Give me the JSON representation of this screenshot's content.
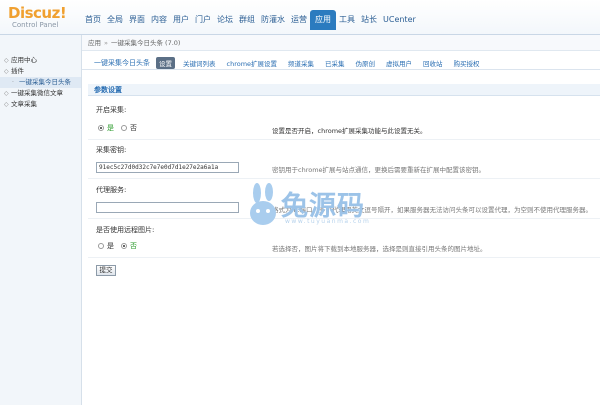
{
  "logo": {
    "main": "Discuz!",
    "sub": "Control Panel"
  },
  "topnav": [
    {
      "label": "首页",
      "active": false
    },
    {
      "label": "全局",
      "active": false
    },
    {
      "label": "界面",
      "active": false
    },
    {
      "label": "内容",
      "active": false
    },
    {
      "label": "用户",
      "active": false
    },
    {
      "label": "门户",
      "active": false
    },
    {
      "label": "论坛",
      "active": false
    },
    {
      "label": "群组",
      "active": false
    },
    {
      "label": "防灌水",
      "active": false
    },
    {
      "label": "运营",
      "active": false
    },
    {
      "label": "应用",
      "active": true
    },
    {
      "label": "工具",
      "active": false
    },
    {
      "label": "站长",
      "active": false
    },
    {
      "label": "UCenter",
      "active": false
    }
  ],
  "sidebar": [
    {
      "label": "应用中心",
      "sub": false,
      "active": false
    },
    {
      "label": "插件",
      "sub": false,
      "active": false
    },
    {
      "label": "一键采集今日头条",
      "sub": true,
      "active": true
    },
    {
      "label": "一键采集微信文章",
      "sub": false,
      "active": false
    },
    {
      "label": "文章采集",
      "sub": false,
      "active": false
    }
  ],
  "breadcrumb": {
    "root": "应用",
    "current": "一键采集今日头条 (7.0)"
  },
  "subnav": {
    "plugin_name": "一键采集今日头条",
    "tabs": [
      {
        "label": "设置",
        "active": true
      },
      {
        "label": "关键词列表",
        "active": false
      },
      {
        "label": "chrome扩展设置",
        "active": false
      },
      {
        "label": "频道采集",
        "active": false
      },
      {
        "label": "已采集",
        "active": false
      },
      {
        "label": "伪原创",
        "active": false
      },
      {
        "label": "虚拟用户",
        "active": false
      },
      {
        "label": "回收站",
        "active": false
      },
      {
        "label": "购买授权",
        "active": false
      }
    ]
  },
  "section": {
    "title": "参数设置"
  },
  "form": {
    "enable": {
      "label": "开启采集:",
      "yes": "是",
      "no": "否",
      "selected": "yes",
      "tip": "设置是否开启，chrome扩展采集功能与此设置无关。"
    },
    "secret": {
      "label": "采集密钥:",
      "value": "91ec5c27d0d32c7e7e0d7d1e27e2a6a1a",
      "tip": "密钥用于chrome扩展与站点通信，更换后需要重新在扩展中配置该密钥。"
    },
    "proxy": {
      "label": "代理服务:",
      "value": "",
      "tip": "格式为IP:端口，多个代理用英文逗号隔开，如果服务器无法访问头条可以设置代理，为空则不使用代理服务器。"
    },
    "image": {
      "label": "是否使用远程图片:",
      "yes": "是",
      "no": "否",
      "selected": "no",
      "tip": "若选择否，图片将下载到本地服务器，选择是则直接引用头条的图片地址。"
    },
    "submit_label": "提交"
  },
  "watermark": {
    "text": "兔源码",
    "url": "www.tuyuanma.com"
  }
}
